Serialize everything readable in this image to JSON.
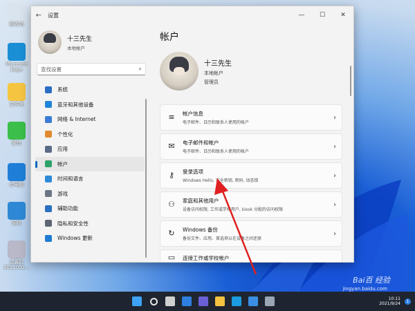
{
  "desktop": {
    "icons": [
      {
        "label": "回收站",
        "color": "#d9e4ee",
        "icon": "recycle-bin-icon"
      },
      {
        "label": "Microsoft Edge",
        "color": "#1a8fd6",
        "icon": "edge-icon"
      },
      {
        "label": "文件夹",
        "color": "#f5c542",
        "icon": "folder-icon"
      },
      {
        "label": "微信",
        "color": "#3bbf4a",
        "icon": "wechat-icon"
      },
      {
        "label": "此电脑",
        "color": "#1f7fd8",
        "icon": "computer-icon"
      },
      {
        "label": "网络",
        "color": "#2f88d6",
        "icon": "network-icon"
      },
      {
        "label": "设置时\n2021091...",
        "color": "#b8b8c8",
        "icon": "file-icon"
      }
    ]
  },
  "window": {
    "title": "设置",
    "back_glyph": "←",
    "minimize": "—",
    "maximize": "☐",
    "close": "✕"
  },
  "sidebar": {
    "profile_name": "十三先生",
    "profile_type": "本地帐户",
    "search_placeholder": "查找设置",
    "items": [
      {
        "label": "系统",
        "color": "#2b6cc4",
        "icon": "system-icon",
        "active": false
      },
      {
        "label": "蓝牙和其他设备",
        "color": "#1f84d9",
        "icon": "bluetooth-icon",
        "active": false
      },
      {
        "label": "网络 & Internet",
        "color": "#3a7bd5",
        "icon": "wifi-icon",
        "active": false
      },
      {
        "label": "个性化",
        "color": "#e08a2e",
        "icon": "brush-icon",
        "active": false
      },
      {
        "label": "应用",
        "color": "#5a6c86",
        "icon": "apps-icon",
        "active": false
      },
      {
        "label": "帐户",
        "color": "#2ea26b",
        "icon": "person-icon",
        "active": true
      },
      {
        "label": "时间和语言",
        "color": "#2c8ad8",
        "icon": "globe-clock-icon",
        "active": false
      },
      {
        "label": "游戏",
        "color": "#6b7585",
        "icon": "gamepad-icon",
        "active": false
      },
      {
        "label": "辅助功能",
        "color": "#2a6fc0",
        "icon": "accessibility-icon",
        "active": false
      },
      {
        "label": "隐私和安全性",
        "color": "#5d6675",
        "icon": "shield-icon",
        "active": false
      },
      {
        "label": "Windows 更新",
        "color": "#1f7bd1",
        "icon": "update-icon",
        "active": false
      }
    ]
  },
  "main": {
    "title": "帐户",
    "account_name": "十三先生",
    "account_type": "本地帐户",
    "account_role": "管理员",
    "cards": [
      {
        "title": "帐户信息",
        "subtitle": "电子邮件、日历和联系人使用的帐户",
        "icon": "account-info-icon",
        "glyph": "≡"
      },
      {
        "title": "电子邮件和帐户",
        "subtitle": "电子邮件、日历和联系人使用的帐户",
        "icon": "mail-icon",
        "glyph": "✉"
      },
      {
        "title": "登录选项",
        "subtitle": "Windows Hello, 安全密钥, 密码, 动态锁",
        "icon": "key-icon",
        "glyph": "⚷"
      },
      {
        "title": "家庭和其他用户",
        "subtitle": "设备访问权限, 工作或学校用户, kiosk 分配的访问权限",
        "icon": "family-icon",
        "glyph": "⚇"
      },
      {
        "title": "Windows 备份",
        "subtitle": "备份文件、应用、首选项以在设备之间还原",
        "icon": "backup-icon",
        "glyph": "↻"
      },
      {
        "title": "连接工作或学校帐户",
        "subtitle": "",
        "icon": "briefcase-icon",
        "glyph": "▭"
      }
    ],
    "chevron": "›"
  },
  "taskbar": {
    "apps": [
      {
        "icon": "windows-start-icon",
        "color": "#3fa2f5"
      },
      {
        "icon": "search-icon",
        "color": "#e8e8e8"
      },
      {
        "icon": "task-view-icon",
        "color": "#d0d0d0"
      },
      {
        "icon": "widgets-icon",
        "color": "#2d7fe0"
      },
      {
        "icon": "teams-chat-icon",
        "color": "#6b5fd6"
      },
      {
        "icon": "file-explorer-icon",
        "color": "#f2c240"
      },
      {
        "icon": "edge-icon",
        "color": "#1d9be0"
      },
      {
        "icon": "store-icon",
        "color": "#3a8fe3"
      },
      {
        "icon": "settings-gear-icon",
        "color": "#9aa6b4"
      }
    ],
    "time": "10:11",
    "date": "2021/9/24",
    "notification_count": "1"
  },
  "watermark": {
    "brand": "Bai百 经验",
    "url": "jingyan.baidu.com"
  }
}
